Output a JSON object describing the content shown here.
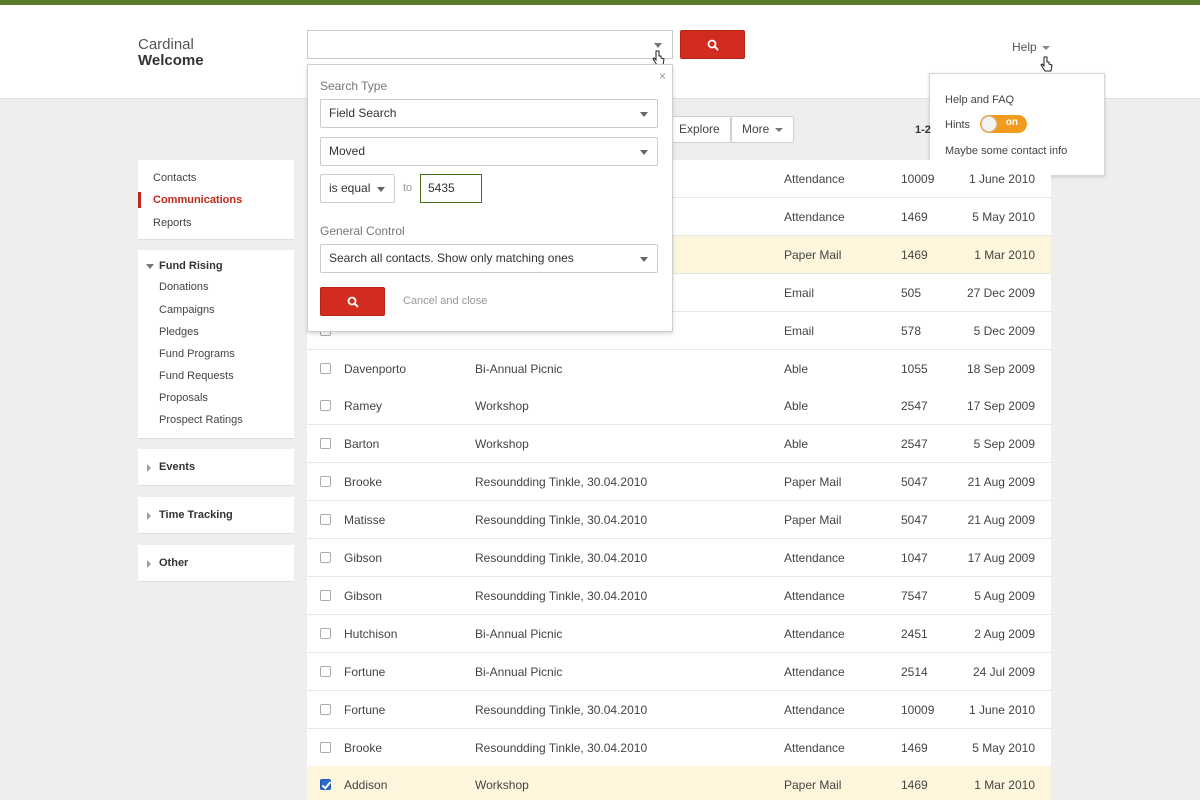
{
  "colors": {
    "accent": "#d22b1f",
    "topbar": "#5b7a2a",
    "toggle": "#f29c1f",
    "highlight": "#fdf6dc"
  },
  "brand": {
    "org": "Cardinal",
    "title": "Welcome"
  },
  "search": {
    "value": "",
    "icon": "search-icon"
  },
  "help": {
    "label": "Help",
    "menu": {
      "faq": "Help and FAQ",
      "hints_label": "Hints",
      "hints_toggle": "on",
      "contact": "Maybe some contact info"
    }
  },
  "panel": {
    "search_type_label": "Search Type",
    "field_search": "Field Search",
    "field": "Moved",
    "operator": "is equal",
    "to_label": "to",
    "value": "5435",
    "general_control_label": "General Control",
    "general_control": "Search all contacts. Show only matching ones",
    "cancel_label": "Cancel and close",
    "close_glyph": "×"
  },
  "toolbar": {
    "explore": "Explore",
    "more": "More",
    "pager": "1-2"
  },
  "sidebar": {
    "top_items": [
      "Contacts",
      "Communications",
      "Reports"
    ],
    "fund_rising": {
      "title": "Fund Rising",
      "items": [
        "Donations",
        "Campaigns",
        "Pledges",
        "Fund Programs",
        "Fund Requests",
        "Proposals",
        "Prospect Ratings"
      ]
    },
    "events": "Events",
    "time_tracking": "Time Tracking",
    "other": "Other"
  },
  "table": {
    "rows": [
      {
        "name": "",
        "event": "",
        "type": "Attendance",
        "id": "10009",
        "date": "1 June 2010",
        "checked": false,
        "highlight": false
      },
      {
        "name": "",
        "event": "",
        "type": "Attendance",
        "id": "1469",
        "date": "5 May 2010",
        "checked": false,
        "highlight": false
      },
      {
        "name": "",
        "event": "",
        "type": "Paper Mail",
        "id": "1469",
        "date": "1 Mar 2010",
        "checked": false,
        "highlight": true
      },
      {
        "name": "",
        "event": "",
        "type": "Email",
        "id": "505",
        "date": "27 Dec 2009",
        "checked": false,
        "highlight": false
      },
      {
        "name": "",
        "event": "",
        "type": "Email",
        "id": "578",
        "date": "5 Dec 2009",
        "checked": false,
        "highlight": false
      },
      {
        "name": "Davenporto",
        "event": "Bi-Annual Picnic",
        "type": "Able",
        "id": "1055",
        "date": "18 Sep 2009",
        "checked": false,
        "highlight": false
      },
      {
        "name": "Ramey",
        "event": "Workshop",
        "type": "Able",
        "id": "2547",
        "date": "17 Sep 2009",
        "checked": false,
        "highlight": false
      },
      {
        "name": "Barton",
        "event": "Workshop",
        "type": "Able",
        "id": "2547",
        "date": "5 Sep 2009",
        "checked": false,
        "highlight": false
      },
      {
        "name": "Brooke",
        "event": "Resoundding Tinkle, 30.04.2010",
        "type": "Paper Mail",
        "id": "5047",
        "date": "21 Aug 2009",
        "checked": false,
        "highlight": false
      },
      {
        "name": "Matisse",
        "event": "Resoundding Tinkle, 30.04.2010",
        "type": "Paper Mail",
        "id": "5047",
        "date": "21 Aug 2009",
        "checked": false,
        "highlight": false
      },
      {
        "name": "Gibson",
        "event": "Resoundding Tinkle, 30.04.2010",
        "type": "Attendance",
        "id": "1047",
        "date": "17 Aug 2009",
        "checked": false,
        "highlight": false
      },
      {
        "name": "Gibson",
        "event": "Resoundding Tinkle, 30.04.2010",
        "type": "Attendance",
        "id": "7547",
        "date": "5 Aug 2009",
        "checked": false,
        "highlight": false
      },
      {
        "name": "Hutchison",
        "event": "Bi-Annual Picnic",
        "type": "Attendance",
        "id": "2451",
        "date": "2 Aug 2009",
        "checked": false,
        "highlight": false
      },
      {
        "name": "Fortune",
        "event": "Bi-Annual Picnic",
        "type": "Attendance",
        "id": "2514",
        "date": "24 Jul 2009",
        "checked": false,
        "highlight": false
      },
      {
        "name": "Fortune",
        "event": "Resoundding Tinkle, 30.04.2010",
        "type": "Attendance",
        "id": "10009",
        "date": "1 June 2010",
        "checked": false,
        "highlight": false
      },
      {
        "name": "Brooke",
        "event": "Resoundding Tinkle, 30.04.2010",
        "type": "Attendance",
        "id": "1469",
        "date": "5 May 2010",
        "checked": false,
        "highlight": false
      },
      {
        "name": "Addison",
        "event": "Workshop",
        "type": "Paper Mail",
        "id": "1469",
        "date": "1 Mar 2010",
        "checked": true,
        "highlight": true
      }
    ]
  }
}
